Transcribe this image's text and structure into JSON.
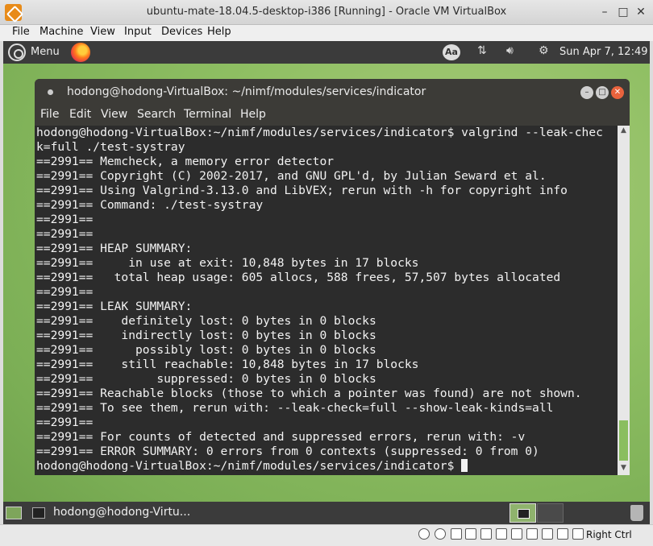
{
  "vbox": {
    "title": "ubuntu-mate-18.04.5-desktop-i386 [Running] - Oracle VM VirtualBox",
    "menu": [
      "File",
      "Machine",
      "View",
      "Input",
      "Devices",
      "Help"
    ],
    "host_key": "Right Ctrl"
  },
  "top_panel": {
    "menu_label": "Menu",
    "aa_label": "Aa",
    "clock": "Sun Apr  7, 12:49"
  },
  "terminal": {
    "title": "hodong@hodong-VirtualBox: ~/nimf/modules/services/indicator",
    "menu": [
      "File",
      "Edit",
      "View",
      "Search",
      "Terminal",
      "Help"
    ],
    "lines": [
      "hodong@hodong-VirtualBox:~/nimf/modules/services/indicator$ valgrind --leak-chec",
      "k=full ./test-systray",
      "==2991== Memcheck, a memory error detector",
      "==2991== Copyright (C) 2002-2017, and GNU GPL'd, by Julian Seward et al.",
      "==2991== Using Valgrind-3.13.0 and LibVEX; rerun with -h for copyright info",
      "==2991== Command: ./test-systray",
      "==2991==",
      "==2991==",
      "==2991== HEAP SUMMARY:",
      "==2991==     in use at exit: 10,848 bytes in 17 blocks",
      "==2991==   total heap usage: 605 allocs, 588 frees, 57,507 bytes allocated",
      "==2991==",
      "==2991== LEAK SUMMARY:",
      "==2991==    definitely lost: 0 bytes in 0 blocks",
      "==2991==    indirectly lost: 0 bytes in 0 blocks",
      "==2991==      possibly lost: 0 bytes in 0 blocks",
      "==2991==    still reachable: 10,848 bytes in 17 blocks",
      "==2991==         suppressed: 0 bytes in 0 blocks",
      "==2991== Reachable blocks (those to which a pointer was found) are not shown.",
      "==2991== To see them, rerun with: --leak-check=full --show-leak-kinds=all",
      "==2991==",
      "==2991== For counts of detected and suppressed errors, rerun with: -v",
      "==2991== ERROR SUMMARY: 0 errors from 0 contexts (suppressed: 0 from 0)",
      "hodong@hodong-VirtualBox:~/nimf/modules/services/indicator$"
    ]
  },
  "bottom_panel": {
    "task_label": "hodong@hodong-Virtu..."
  },
  "colors": {
    "accent": "#8abe5f",
    "terminal_bg": "#2c2c2c",
    "panel_bg": "#3b3b3b"
  }
}
